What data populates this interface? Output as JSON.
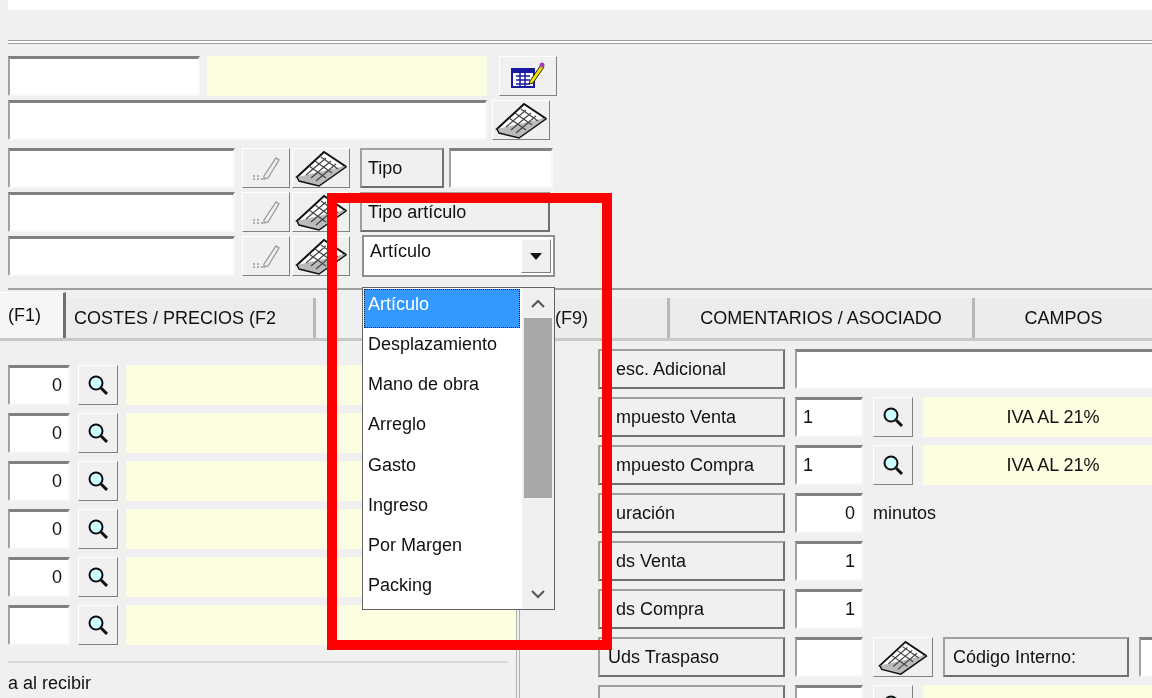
{
  "top_form": {
    "tipo_label": "Tipo",
    "tipo_articulo_label": "Tipo artículo",
    "tipo_articulo_value": "Artículo"
  },
  "dropdown": {
    "expanded": true,
    "options": [
      {
        "label": "Artículo",
        "selected": true
      },
      {
        "label": "Desplazamiento",
        "selected": false
      },
      {
        "label": "Mano de obra",
        "selected": false
      },
      {
        "label": "Arreglo",
        "selected": false
      },
      {
        "label": "Gasto",
        "selected": false
      },
      {
        "label": "Ingreso",
        "selected": false
      },
      {
        "label": "Por Margen",
        "selected": false
      },
      {
        "label": "Packing",
        "selected": false
      }
    ]
  },
  "tabs": [
    {
      "label": "(F1)",
      "selected": true
    },
    {
      "label": "COSTES / PRECIOS (F2",
      "selected": false
    },
    {
      "label": "(F9)",
      "selected": false
    },
    {
      "label": "COMENTARIOS / ASOCIADO",
      "selected": false
    },
    {
      "label": "CAMPOS",
      "selected": false
    }
  ],
  "left_panel": {
    "rows": [
      {
        "kind": "number",
        "value": "0"
      },
      {
        "kind": "number",
        "value": "0"
      },
      {
        "kind": "number",
        "value": "0"
      },
      {
        "kind": "number",
        "value": "0"
      },
      {
        "kind": "number",
        "value": "0"
      },
      {
        "kind": "blank"
      }
    ],
    "note": "a al recibir"
  },
  "right_panel": {
    "rows": [
      {
        "kind": "text",
        "label": "esc. Adicional"
      },
      {
        "kind": "lookup",
        "label": "mpuesto Venta",
        "value": "1",
        "description": "IVA AL 21%"
      },
      {
        "kind": "lookup",
        "label": "mpuesto Compra",
        "value": "1",
        "description": "IVA AL 21%"
      },
      {
        "kind": "number",
        "label": "uración",
        "value": "0",
        "unit": "minutos"
      },
      {
        "kind": "number",
        "label": "ds Venta",
        "value": "1"
      },
      {
        "kind": "number",
        "label": "ds Compra",
        "value": "1"
      },
      {
        "kind": "code",
        "label": "Uds Traspaso",
        "extra_label": "Código Interno:"
      },
      {
        "kind": "lookup_blank"
      }
    ]
  }
}
